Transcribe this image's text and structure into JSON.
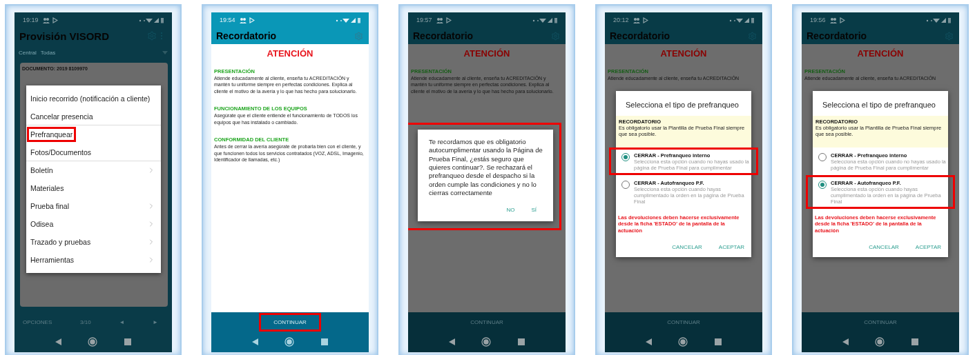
{
  "phones": [
    {
      "kind": "menu",
      "dimmed": true,
      "status_time": "19:19",
      "title": "Provisión VISORD",
      "filters": [
        "Central",
        "Todas"
      ],
      "document": "DOCUMENTO: 2019 8109970",
      "menu": [
        {
          "label": "Inicio recorrido (notificación a cliente)",
          "submenu": false,
          "divider_after": false,
          "highlighted": false
        },
        {
          "label": "Cancelar presencia",
          "submenu": false,
          "divider_after": true,
          "highlighted": false
        },
        {
          "label": "Prefranquear",
          "submenu": false,
          "divider_after": false,
          "highlighted": true
        },
        {
          "label": "Fotos/Documentos",
          "submenu": false,
          "divider_after": true,
          "highlighted": false
        },
        {
          "label": "Boletín",
          "submenu": true,
          "divider_after": false,
          "highlighted": false
        },
        {
          "label": "Materiales",
          "submenu": false,
          "divider_after": false,
          "highlighted": false
        },
        {
          "label": "Prueba final",
          "submenu": true,
          "divider_after": false,
          "highlighted": false
        },
        {
          "label": "Odisea",
          "submenu": true,
          "divider_after": false,
          "highlighted": false
        },
        {
          "label": "Trazado y pruebas",
          "submenu": true,
          "divider_after": false,
          "highlighted": false
        },
        {
          "label": "Herramientas",
          "submenu": true,
          "divider_after": false,
          "highlighted": false
        }
      ],
      "footer": {
        "options": "OPCIONES",
        "page": "3/10",
        "prev": "◄",
        "next": "►"
      }
    },
    {
      "kind": "reminder",
      "dimmed": false,
      "status_time": "19:54",
      "title": "Recordatorio",
      "heading": "ATENCIÓN",
      "sections": [
        {
          "title": "PRESENTACIÓN",
          "text": "Atiende educadamente al cliente, enseña tu ACREDITACIÓN y mantén tu uniforme siempre en perfectas condiciones. Explica al cliente el motivo de la avería y lo que has hecho para solucionarlo."
        },
        {
          "title": "FUNCIONAMIENTO DE LOS EQUIPOS",
          "text": "Asegúrate que el cliente entiende el funcionamiento de TODOS los equipos que has instalado o cambiado."
        },
        {
          "title": "CONFORMIDAD DEL CLIENTE",
          "text": "Antes de cerrar la avería asegúrate de probarla bien con el cliente, y que funcionen todos los servicios contratados (VOZ, ADSL, Imagenio, Identificador de llamadas, etc.)"
        }
      ],
      "continue": {
        "label": "CONTINUAR",
        "highlighted": true
      }
    },
    {
      "kind": "reminder",
      "dimmed": true,
      "status_time": "19:57",
      "title": "Recordatorio",
      "heading": "ATENCIÓN",
      "sections": [
        {
          "title": "PRESENTACIÓN",
          "text": "Atiende educadamente al cliente, enseña tu ACREDITACIÓN y mantén tu uniforme siempre en perfectas condiciones. Explica al cliente el motivo de la avería y lo que has hecho para solucionarlo."
        }
      ],
      "continue": {
        "label": "CONTINUAR",
        "highlighted": false
      },
      "dialog": {
        "kind": "confirm",
        "highlighted": true,
        "text": "Te recordamos que es obligatorio autocumplimentar usando la Página de Prueba Final, ¿estás seguro que quieres continuar?. Se rechazará el prefranqueo desde el despacho si la orden cumple las condiciones y no lo cierras correctamente",
        "buttons": [
          "NO",
          "SÍ"
        ]
      }
    },
    {
      "kind": "reminder",
      "dimmed": true,
      "status_time": "20:12",
      "title": "Recordatorio",
      "heading": "ATENCIÓN",
      "sections": [
        {
          "title": "PRESENTACIÓN",
          "text": "Atiende educadamente al cliente, enseña tu ACREDITACIÓN"
        }
      ],
      "continue": {
        "label": "CONTINUAR",
        "highlighted": false
      },
      "dialog": {
        "kind": "choice",
        "title": "Selecciona el tipo de prefranqueo",
        "notice": {
          "title": "RECORDATORIO",
          "text": "Es obligatorio usar la Plantilla de Prueba Final siempre que sea posible."
        },
        "options": [
          {
            "label": "CERRAR - Prefranqueo interno",
            "description": "Selecciona esta opción cuando no hayas usado la página de Prueba Final para cumplimentar",
            "selected": true,
            "highlighted": true
          },
          {
            "label": "CERRAR - Autofranqueo P.F.",
            "description": "Selecciona esta opción cuando hayas cumplimentado la orden en la página de Prueba Final",
            "selected": false,
            "highlighted": false
          }
        ],
        "warning": "Las devoluciones deben hacerse exclusivamente desde la ficha 'ESTADO' de la pantalla de la actuación",
        "buttons": [
          "CANCELAR",
          "ACEPTAR"
        ]
      }
    },
    {
      "kind": "reminder",
      "dimmed": true,
      "status_time": "19:56",
      "title": "Recordatorio",
      "heading": "ATENCIÓN",
      "sections": [
        {
          "title": "PRESENTACIÓN",
          "text": "Atiende educadamente al cliente, enseña tu ACREDITACIÓN"
        }
      ],
      "continue": {
        "label": "CONTINUAR",
        "highlighted": false
      },
      "dialog": {
        "kind": "choice",
        "title": "Selecciona el tipo de prefranqueo",
        "notice": {
          "title": "RECORDATORIO",
          "text": "Es obligatorio usar la Plantilla de Prueba Final siempre que sea posible."
        },
        "options": [
          {
            "label": "CERRAR - Prefranqueo interno",
            "description": "Selecciona esta opción cuando no hayas usado la página de Prueba Final para cumplimentar",
            "selected": false,
            "highlighted": false
          },
          {
            "label": "CERRAR - Autofranqueo P.F.",
            "description": "Selecciona esta opción cuando hayas cumplimentado la orden en la página de Prueba Final",
            "selected": true,
            "highlighted": true
          }
        ],
        "warning": "Las devoluciones deben hacerse exclusivamente desde la ficha 'ESTADO' de la pantalla de la actuación",
        "buttons": [
          "CANCELAR",
          "ACEPTAR"
        ]
      }
    }
  ]
}
